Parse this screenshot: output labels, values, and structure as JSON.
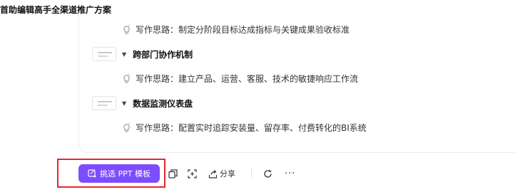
{
  "document": {
    "title": "首助编辑高手全渠道推广方案"
  },
  "outline": {
    "items": [
      {
        "type": "idea",
        "text": "写作思路：制定分阶段目标达成指标与关键成果验收标准"
      },
      {
        "type": "heading",
        "text": "跨部门协作机制"
      },
      {
        "type": "idea",
        "text": "写作思路：建立产品、运营、客服、技术的敏捷响应工作流"
      },
      {
        "type": "heading",
        "text": "数据监测仪表盘"
      },
      {
        "type": "idea",
        "text": "写作思路：配置实时追踪安装量、留存率、付费转化的BI系统"
      }
    ]
  },
  "toolbar": {
    "ppt_button_label": "挑选 PPT 模板",
    "share_label": "分享",
    "more_label": "···",
    "accent_color": "#7c4dff",
    "highlight_color": "#e5262a",
    "icons": [
      "edit-template-icon",
      "copy-icon",
      "screenshot-icon",
      "share-icon",
      "refresh-icon",
      "more-icon"
    ]
  }
}
